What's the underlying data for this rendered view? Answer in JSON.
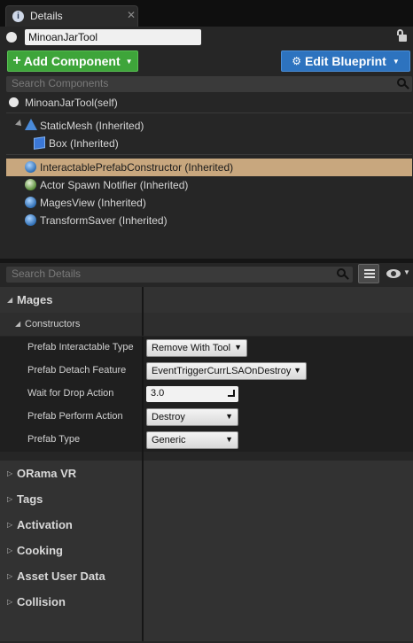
{
  "tab": {
    "title": "Details",
    "close": "✕"
  },
  "actor": {
    "name": "MinoanJarTool"
  },
  "toolbar": {
    "add_component": "Add Component",
    "edit_blueprint": "Edit Blueprint",
    "plus": "+",
    "caret": "▼",
    "gears": "⚙"
  },
  "search_components": {
    "placeholder": "Search Components"
  },
  "components": [
    {
      "label": "MinoanJarTool(self)"
    },
    {
      "label": "StaticMesh (Inherited)"
    },
    {
      "label": "Box (Inherited)"
    },
    {
      "label": "InteractablePrefabConstructor (Inherited)",
      "selected": true
    },
    {
      "label": "Actor Spawn Notifier (Inherited)"
    },
    {
      "label": "MagesView (Inherited)"
    },
    {
      "label": "TransformSaver (Inherited)"
    }
  ],
  "search_details": {
    "placeholder": "Search Details"
  },
  "details": {
    "mages": {
      "label": "Mages",
      "arrow": "◢"
    },
    "constructors": {
      "label": "Constructors",
      "arrow": "◢"
    },
    "props": [
      {
        "name": "Prefab Interactable Type",
        "value": "Remove With Tool"
      },
      {
        "name": "Prefab Detach Feature",
        "value": "EventTriggerCurrLSAOnDestroy"
      },
      {
        "name": "Wait for Drop Action",
        "value": "3.0"
      },
      {
        "name": "Prefab Perform Action",
        "value": "Destroy"
      },
      {
        "name": "Prefab Type",
        "value": "Generic"
      }
    ],
    "categories": [
      {
        "label": "ORama VR",
        "arrow": "▷"
      },
      {
        "label": "Tags",
        "arrow": "▷"
      },
      {
        "label": "Activation",
        "arrow": "▷"
      },
      {
        "label": "Cooking",
        "arrow": "▷"
      },
      {
        "label": "Asset User Data",
        "arrow": "▷"
      },
      {
        "label": "Collision",
        "arrow": "▷"
      }
    ]
  },
  "colors": {
    "add_green": "#3ea53a",
    "blueprint_blue": "#2d73bf",
    "selection": "#c8a77e"
  }
}
